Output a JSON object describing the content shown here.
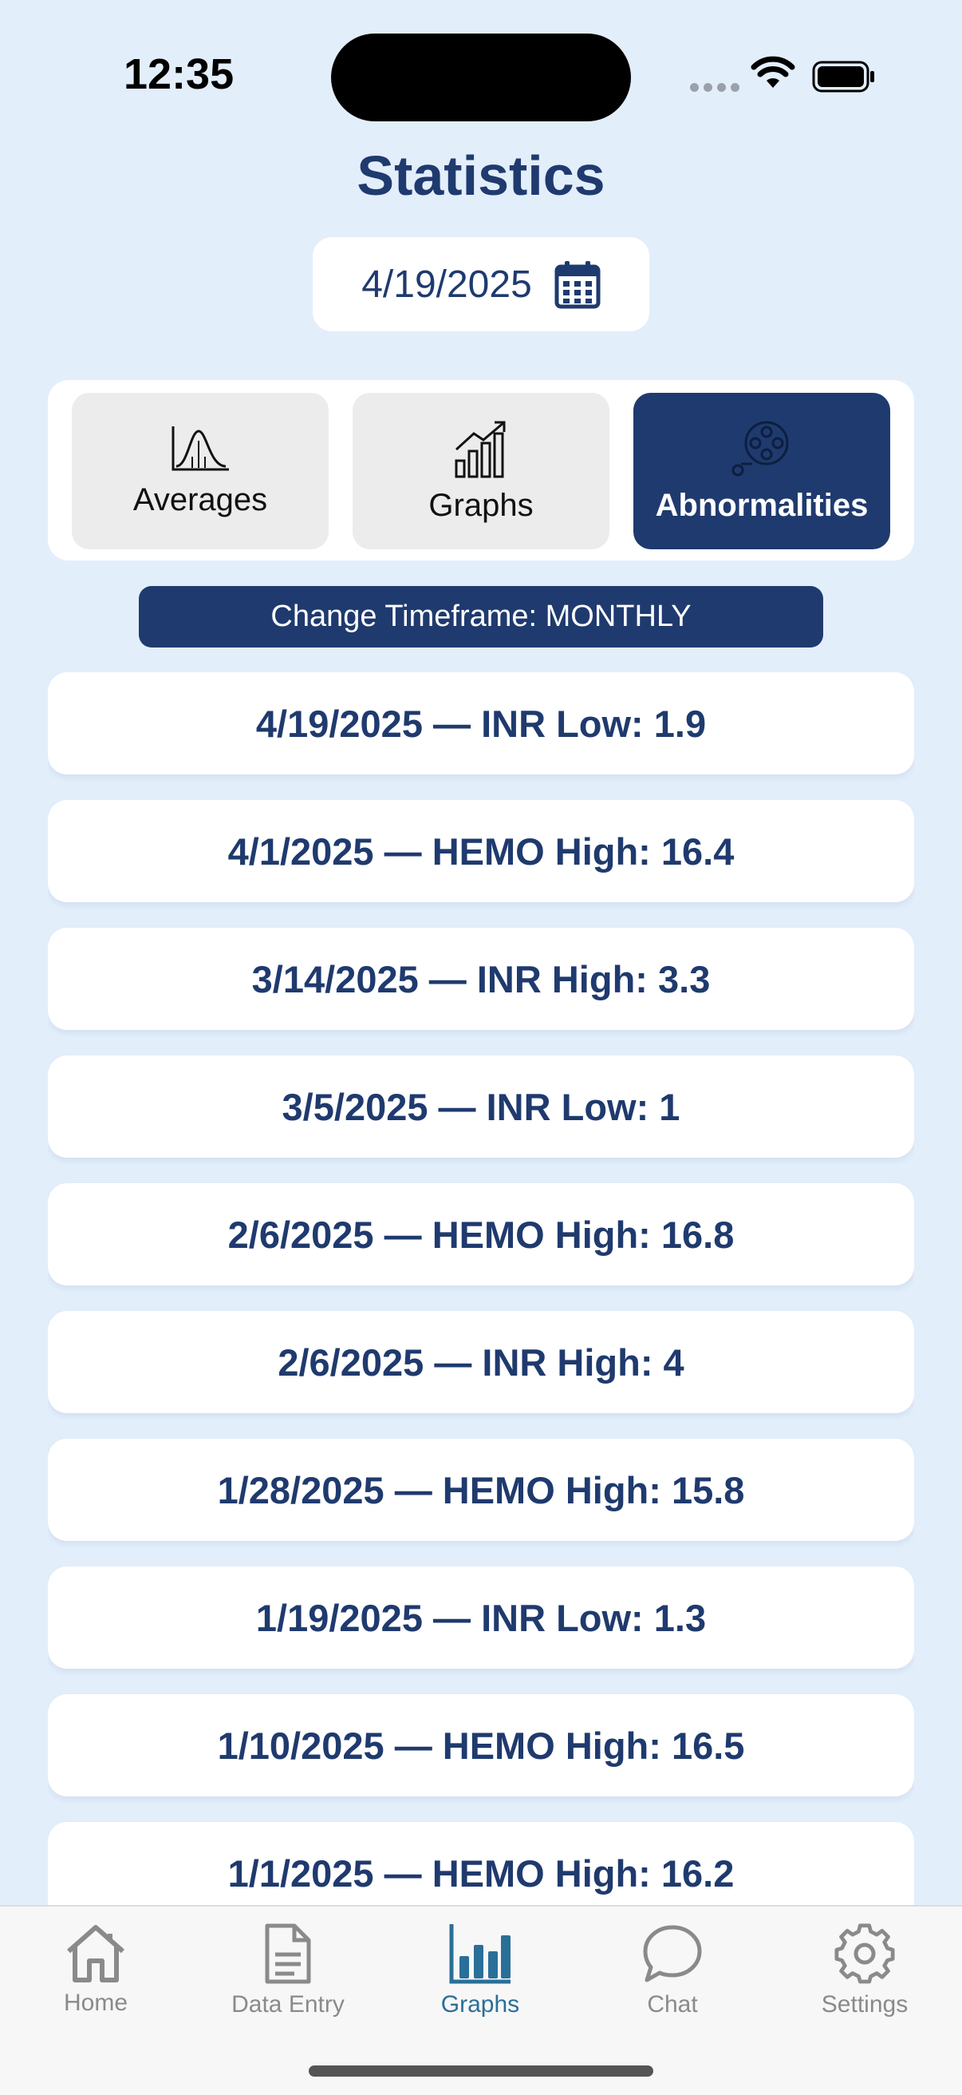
{
  "status_bar": {
    "time": "12:35"
  },
  "header": {
    "title": "Statistics"
  },
  "date_picker": {
    "value": "4/19/2025",
    "icon": "calendar-icon"
  },
  "segments": [
    {
      "label": "Averages",
      "icon": "bell-curve-icon",
      "active": false
    },
    {
      "label": "Graphs",
      "icon": "bar-trend-icon",
      "active": false
    },
    {
      "label": "Abnormalities",
      "icon": "film-reel-icon",
      "active": true
    }
  ],
  "timeframe_button": {
    "label": "Change Timeframe: MONTHLY"
  },
  "abnormalities": [
    "4/19/2025 — INR Low: 1.9",
    "4/1/2025 — HEMO High: 16.4",
    "3/14/2025 — INR High: 3.3",
    "3/5/2025 — INR Low: 1",
    "2/6/2025 — HEMO High: 16.8",
    "2/6/2025 — INR High: 4",
    "1/28/2025 — HEMO High: 15.8",
    "1/19/2025 — INR Low: 1.3",
    "1/10/2025 — HEMO High: 16.5",
    "1/1/2025 — HEMO High: 16.2"
  ],
  "tabbar": {
    "items": [
      {
        "label": "Home",
        "icon": "home-icon"
      },
      {
        "label": "Data Entry",
        "icon": "document-icon"
      },
      {
        "label": "Graphs",
        "icon": "bar-chart-icon",
        "active": true
      },
      {
        "label": "Chat",
        "icon": "chat-bubble-icon"
      },
      {
        "label": "Settings",
        "icon": "gear-icon"
      }
    ]
  },
  "colors": {
    "accent": "#1f3a6e",
    "background": "#e3eefb",
    "tab_active": "#2a6f97"
  }
}
